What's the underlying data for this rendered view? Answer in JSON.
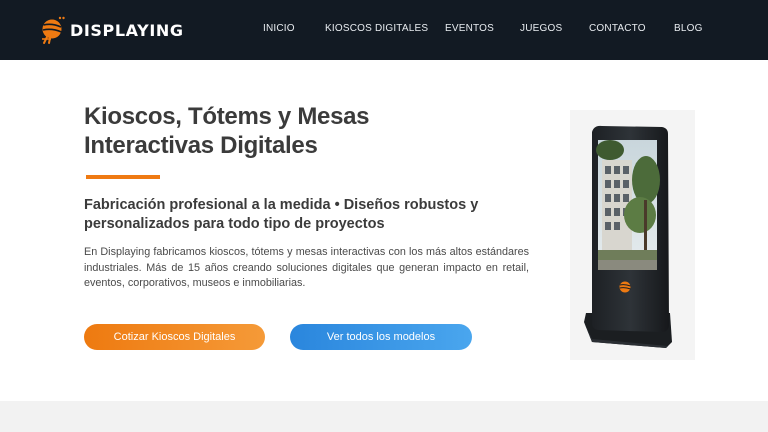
{
  "header": {
    "logo_text": "DISPLAYING",
    "nav": [
      {
        "label": "INICIO"
      },
      {
        "label": "KIOSCOS DIGITALES"
      },
      {
        "label": "EVENTOS"
      },
      {
        "label": "JUEGOS"
      },
      {
        "label": "CONTACTO"
      },
      {
        "label": "BLOG"
      }
    ]
  },
  "hero": {
    "title_line1": "Kioscos, Tótems y Mesas",
    "title_line2": "Interactivas Digitales",
    "subtitle": "Fabricación profesional a la medida • Diseños robustos y personalizados para todo tipo de proyectos",
    "body": "En Displaying fabricamos kioscos, tótems y mesas interactivas con los más altos estándares industriales. Más de 15 años creando soluciones digitales que generan impacto en retail, eventos, corporativos, museos e inmobiliarias.",
    "primary_button": "Cotizar Kioscos Digitales",
    "secondary_button": "Ver todos los modelos"
  },
  "colors": {
    "header_bg": "#121a23",
    "accent_orange": "#ef7a12",
    "accent_blue": "#3595e4",
    "title_text": "#3b3b3b"
  },
  "icons": {
    "logo": "displaying-bird-logo-icon",
    "kiosk_image": "digital-kiosk-totem-image"
  }
}
